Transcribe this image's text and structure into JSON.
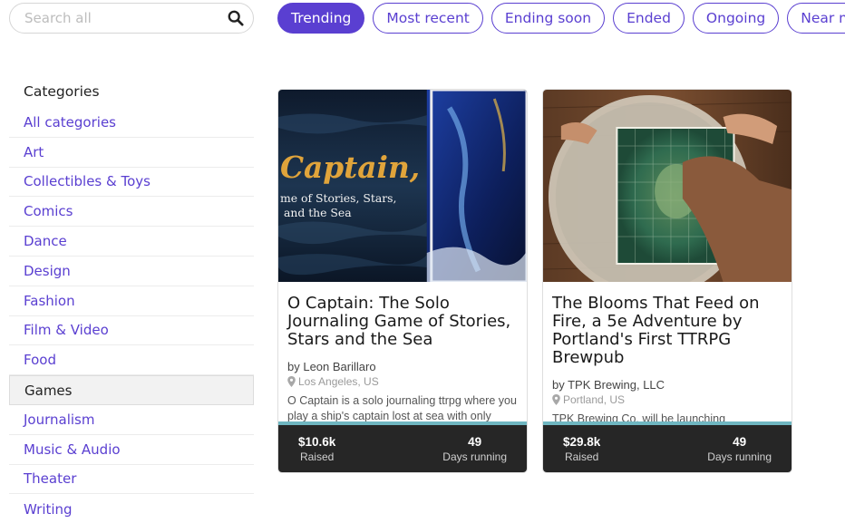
{
  "search": {
    "placeholder": "Search all",
    "value": ""
  },
  "filters": [
    {
      "label": "Trending",
      "active": true
    },
    {
      "label": "Most recent",
      "active": false
    },
    {
      "label": "Ending soon",
      "active": false
    },
    {
      "label": "Ended",
      "active": false
    },
    {
      "label": "Ongoing",
      "active": false
    },
    {
      "label": "Near me",
      "active": false
    }
  ],
  "sidebar": {
    "heading": "Categories",
    "items": [
      {
        "label": "All categories"
      },
      {
        "label": "Art"
      },
      {
        "label": "Collectibles & Toys"
      },
      {
        "label": "Comics"
      },
      {
        "label": "Dance"
      },
      {
        "label": "Design"
      },
      {
        "label": "Fashion"
      },
      {
        "label": "Film & Video"
      },
      {
        "label": "Food"
      },
      {
        "label": "Games",
        "selected": true
      },
      {
        "label": "Journalism"
      },
      {
        "label": "Music & Audio"
      },
      {
        "label": "Theater"
      },
      {
        "label": "Writing"
      }
    ]
  },
  "cards": [
    {
      "cover_text": [
        "Captain,",
        "me of Stories, Stars,",
        "and the Sea"
      ],
      "title": "O Captain: The Solo Journaling Game of Stories, Stars and the Sea",
      "by": "by Leon Barillaro",
      "location": "Los Angeles, US",
      "description": "O Captain is a solo journaling ttrpg where you play a ship's captain lost at sea with only",
      "progress": 1.0,
      "raised": "$10.6k",
      "raised_label": "Raised",
      "days": "49",
      "days_label": "Days running"
    },
    {
      "title": "The Blooms That Feed on Fire, a 5e Adventure by Portland's First TTRPG Brewpub",
      "by": "by TPK Brewing, LLC",
      "location": "Portland, US",
      "description": "TPK Brewing Co. will be launching",
      "progress": 1.0,
      "raised": "$29.8k",
      "raised_label": "Raised",
      "days": "49",
      "days_label": "Days running"
    }
  ],
  "colors": {
    "accent": "#5a3fd1",
    "footer": "#262626",
    "progress": "#6fb6c1"
  }
}
